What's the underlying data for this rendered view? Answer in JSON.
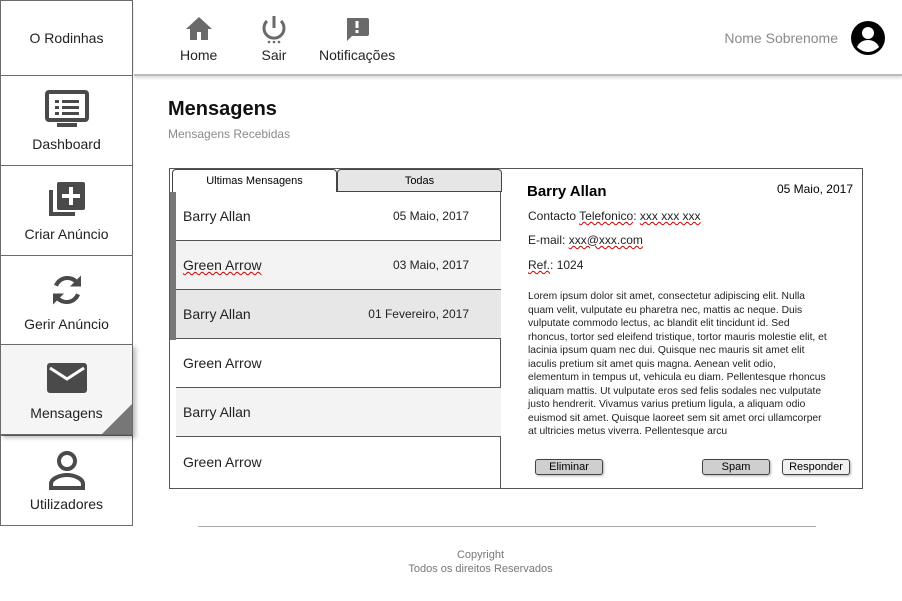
{
  "sidebar": {
    "brand": "O Rodinhas",
    "items": [
      {
        "label": "Dashboard",
        "icon": "dashboard-icon"
      },
      {
        "label": "Criar Anúncio",
        "icon": "add-library-icon"
      },
      {
        "label": "Gerir Anúncio",
        "icon": "sync-icon"
      },
      {
        "label": "Mensagens",
        "icon": "mail-icon",
        "active": true
      },
      {
        "label": "Utilizadores",
        "icon": "user-icon"
      }
    ]
  },
  "topbar": {
    "nav": [
      {
        "label": "Home",
        "icon": "home-icon"
      },
      {
        "label": "Sair",
        "icon": "power-icon"
      },
      {
        "label": "Notificações",
        "icon": "notification-icon"
      }
    ],
    "user_name": "Nome Sobrenome",
    "user_icon": "account-circle-icon"
  },
  "page": {
    "title": "Mensagens",
    "subtitle": "Mensagens Recebidas"
  },
  "tabs": [
    "Ultimas Mensagens",
    "Todas"
  ],
  "messages": [
    {
      "name": "Barry Allan",
      "date": "05 Maio, 2017"
    },
    {
      "name": "Green Arrow",
      "date": "03 Maio, 2017"
    },
    {
      "name": "Barry Allan",
      "date": "01 Fevereiro, 2017"
    },
    {
      "name": "Green Arrow",
      "date": ""
    },
    {
      "name": "Barry Allan",
      "date": ""
    },
    {
      "name": "Green Arrow",
      "date": ""
    }
  ],
  "detail": {
    "name": "Barry Allan",
    "date": "05 Maio, 2017",
    "contact_label": "Contacto",
    "contact_label2": "Telefonico",
    "contact_value": "xxx xxx xxx",
    "email_label": "E-mail:",
    "email_value": "xxx@xxx.com",
    "ref_label": "Ref.",
    "ref_value": "1024",
    "body": "Lorem ipsum dolor sit amet, consectetur adipiscing elit. Nulla quam velit, vulputate eu pharetra nec, mattis ac neque. Duis vulputate commodo lectus, ac blandit elit tincidunt id. Sed rhoncus, tortor sed eleifend tristique, tortor mauris molestie elit, et lacinia ipsum quam nec dui. Quisque nec mauris sit amet elit iaculis pretium sit amet quis magna. Aenean velit odio, elementum in tempus ut, vehicula eu diam. Pellentesque rhoncus aliquam mattis. Ut vulputate eros sed felis sodales nec vulputate justo hendrerit. Vivamus varius pretium ligula, a aliquam odio euismod sit amet. Quisque laoreet sem sit amet orci ullamcorper at ultricies metus viverra. Pellentesque arcu"
  },
  "actions": {
    "delete": "Eliminar",
    "spam": "Spam",
    "reply": "Responder"
  },
  "footer": {
    "line1": "Copyright",
    "line2": "Todos os direitos Reservados"
  }
}
